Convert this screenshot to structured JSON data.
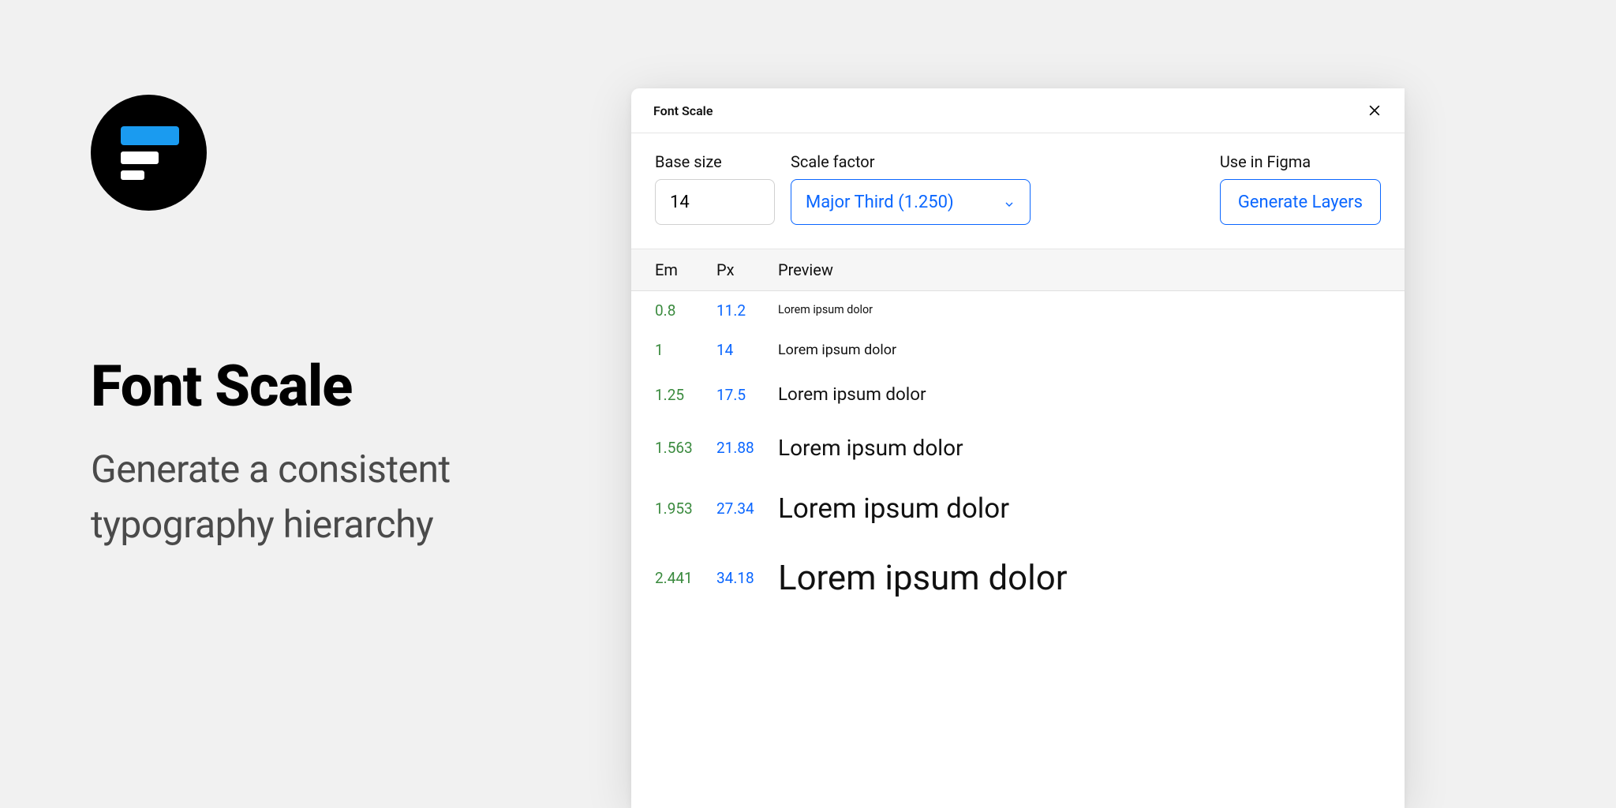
{
  "hero": {
    "title": "Font Scale",
    "subtitle": "Generate a consistent typography hierarchy"
  },
  "panel": {
    "title": "Font Scale",
    "controls": {
      "base_label": "Base size",
      "base_value": "14",
      "scale_label": "Scale factor",
      "scale_value": "Major Third (1.250)",
      "use_label": "Use in Figma",
      "generate_label": "Generate Layers"
    },
    "columns": {
      "em": "Em",
      "px": "Px",
      "preview": "Preview"
    },
    "preview_text": "Lorem ipsum dolor",
    "rows": [
      {
        "em": "0.8",
        "px": "11.2",
        "size": 11.2
      },
      {
        "em": "1",
        "px": "14",
        "size": 14
      },
      {
        "em": "1.25",
        "px": "17.5",
        "size": 17.5
      },
      {
        "em": "1.563",
        "px": "21.88",
        "size": 21.88
      },
      {
        "em": "1.953",
        "px": "27.34",
        "size": 27.34
      },
      {
        "em": "2.441",
        "px": "34.18",
        "size": 34.18
      }
    ]
  }
}
